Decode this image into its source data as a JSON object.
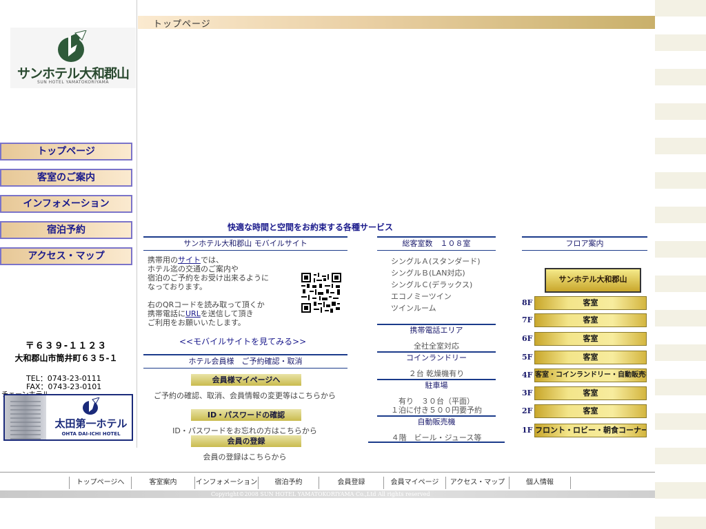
{
  "header": {
    "page_title": "トップページ"
  },
  "logo": {
    "name": "サンホテル大和郡山",
    "subtitle": "SUN HOTEL YAMATOKORIYAMA"
  },
  "nav": {
    "items": [
      {
        "label": "トップページ"
      },
      {
        "label": "客室のご案内"
      },
      {
        "label": "インフォメーション"
      },
      {
        "label": "宿泊予約"
      },
      {
        "label": "アクセス・マップ"
      }
    ]
  },
  "address": {
    "postal": "〒６３９-１１２３",
    "street": "大和郡山市筒井町６３５-１",
    "tel": "TEL：0743-23-0111",
    "fax": "FAX：0743-23-0101"
  },
  "chain": {
    "label": "チェーンホテル",
    "name": "太田第一ホテル",
    "name_en": "OHTA DAI-ICHI HOTEL"
  },
  "services": {
    "title": "快適な時間と空間をお約束する各種サービス"
  },
  "mobile": {
    "heading": "サンホテル大和郡山 モバイルサイト",
    "intro_1": "携帯用の",
    "intro_link": "サイト",
    "intro_2": "では、",
    "line2": "ホテル迄の交通のご案内や",
    "line3": "宿泊のご予約をお受け出来るように",
    "line4": "なっております。",
    "line5": "右のQRコードを読み取って頂くか",
    "line6a": "携帯電話に",
    "line6link": "URL",
    "line6b": "を送信して頂き",
    "line7": "ご利用をお願いいたします。",
    "link": "<<モバイルサイトを見てみる>>"
  },
  "member": {
    "heading": "ホテル会員様　ご予約確認・取消",
    "btn_mypage": "会員様マイページへ",
    "text_mypage": "ご予約の確認、取消、会員情報の変更等はこちらから",
    "btn_id": "ID・パスワードの確認",
    "text_id": "ID・パスワードをお忘れの方はこちらから",
    "btn_register": "会員の登録",
    "text_register": "会員の登録はこちらから"
  },
  "rooms": {
    "heading": "総客室数　１０８室",
    "list": [
      "シングルＡ(スタンダード)",
      "シングルＢ(LAN対応)",
      "シングルＣ(デラックス)",
      "エコノミーツイン",
      "ツインルーム"
    ]
  },
  "mobile_area": {
    "heading": "携帯電話エリア",
    "text": "全社全室対応"
  },
  "laundry": {
    "heading": "コインランドリー",
    "text": "２台 乾燥機有り"
  },
  "parking": {
    "heading": "駐車場",
    "text1": "有り　３０台（平面）",
    "text2": "１泊に付き５００円要予約"
  },
  "vending": {
    "heading": "自動販売機",
    "text": "４階　ビール・ジュース等"
  },
  "floors": {
    "heading": "フロア案内",
    "banner": "サンホテル大和郡山",
    "list": [
      {
        "floor": "8F",
        "label": "客室"
      },
      {
        "floor": "7F",
        "label": "客室"
      },
      {
        "floor": "6F",
        "label": "客室"
      },
      {
        "floor": "5F",
        "label": "客室"
      },
      {
        "floor": "4F",
        "label": "客室・コインランドリー・自動販売機"
      },
      {
        "floor": "3F",
        "label": "客室"
      },
      {
        "floor": "2F",
        "label": "客室"
      },
      {
        "floor": "1F",
        "label": "フロント・ロビー・朝食コーナー"
      }
    ]
  },
  "footer": {
    "links": [
      "トップページへ",
      "客室案内",
      "インフォメーション",
      "宿泊予約",
      "会員登録",
      "会員マイページ",
      "アクセス・マップ",
      "個人情報"
    ],
    "copyright": "Copyright©2008 SUN HOTEL YAMATOKORIYAMA Co.,Ltd All rights reserved"
  },
  "colors": {
    "nav_text": "#1a1a8c",
    "nav_border": "#7a73c9",
    "section_line": "#1a3a8a",
    "gold": "#c9a72c"
  }
}
